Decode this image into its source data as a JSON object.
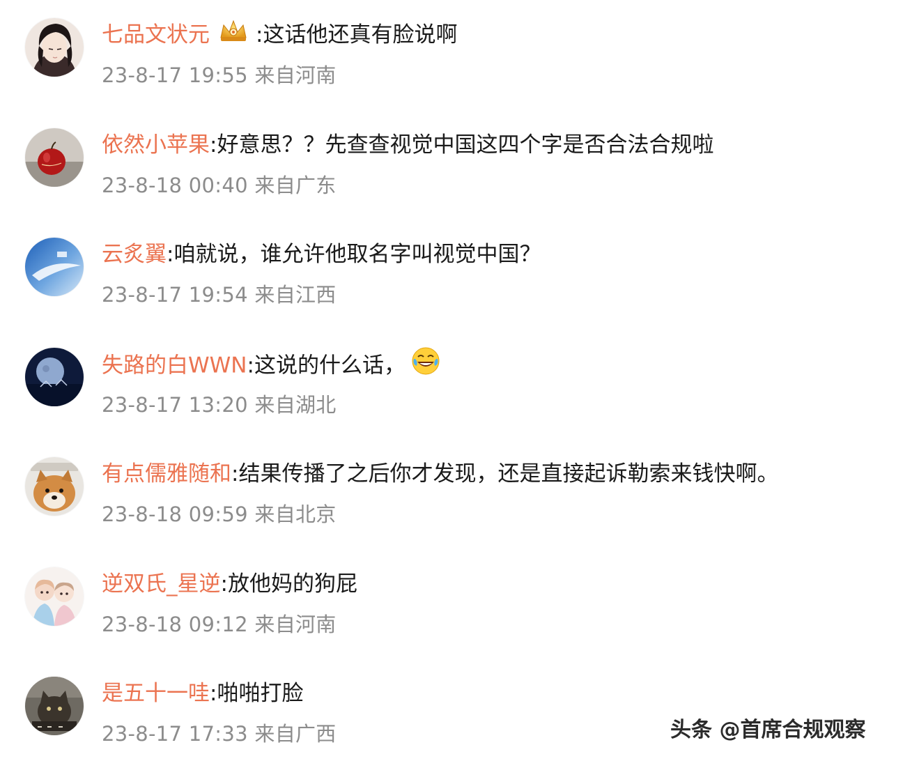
{
  "comments": [
    {
      "username": "七品文状元",
      "text": ":这话他还真有脸说啊",
      "time": "23-8-17 19:55",
      "location": "来自河南",
      "avatar_icon": "anime-man-avatar",
      "badge_icon": "crown-badge-icon"
    },
    {
      "username": "依然小苹果",
      "text": ":好意思？？先查查视觉中国这四个字是否合法合规啦",
      "time": "23-8-18 00:40",
      "location": "来自广东",
      "avatar_icon": "red-apple-avatar"
    },
    {
      "username": "云炙翼",
      "text": ":咱就说，谁允许他取名字叫视觉中国？",
      "time": "23-8-17 19:54",
      "location": "来自江西",
      "avatar_icon": "blue-sky-avatar"
    },
    {
      "username": "失路的白WWN",
      "text": ":这说的什么话，",
      "time": "23-8-17 13:20",
      "location": "来自湖北",
      "avatar_icon": "night-moon-avatar",
      "emoji_icon": "laughing-tears-emoji-icon"
    },
    {
      "username": "有点儒雅随和",
      "text": ":结果传播了之后你才发现，还是直接起诉勒索来钱快啊。",
      "time": "23-8-18 09:59",
      "location": "来自北京",
      "avatar_icon": "shiba-dog-avatar"
    },
    {
      "username": "逆双氏_星逆",
      "text": ":放他妈的狗屁",
      "time": "23-8-18 09:12",
      "location": "来自河南",
      "avatar_icon": "cartoon-kids-avatar"
    },
    {
      "username": "是五十一哇",
      "text": ":啪啪打脸",
      "time": "23-8-17 17:33",
      "location": "来自广西",
      "avatar_icon": "dark-cat-avatar"
    }
  ],
  "watermark": "头条 @首席合规观察",
  "colors": {
    "username": "#eb7350",
    "body_text": "#1a1a1a",
    "meta_text": "#8c8c8c",
    "background": "#ffffff"
  }
}
